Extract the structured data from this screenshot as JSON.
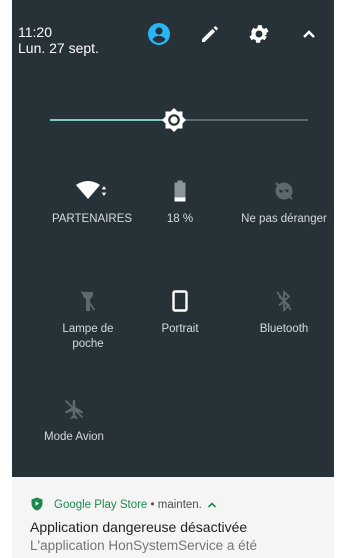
{
  "header": {
    "time": "11:20",
    "date": "Lun. 27 sept.",
    "icons": [
      "account-icon",
      "edit-icon",
      "settings-icon",
      "collapse-icon"
    ]
  },
  "brightness": {
    "level": 0.48
  },
  "tiles": [
    {
      "label": "PARTENAIRES",
      "icon": "wifi-icon",
      "active": true
    },
    {
      "label": "18 %",
      "icon": "battery-icon",
      "active": true
    },
    {
      "label": "Ne pas déranger",
      "icon": "do-not-disturb-icon",
      "active": false
    },
    {
      "label": "Lampe de poche",
      "icon": "flashlight-icon",
      "active": false
    },
    {
      "label": "Portrait",
      "icon": "portrait-icon",
      "active": true
    },
    {
      "label": "Bluetooth",
      "icon": "bluetooth-icon",
      "active": false
    },
    {
      "label": "Mode Avion",
      "icon": "airplane-icon",
      "active": false
    }
  ],
  "notification": {
    "app": "Google Play Store",
    "separator": " • ",
    "status": "mainten.",
    "title": "Application dangereuse désactivée",
    "body": "L'application HonSystemService a été"
  },
  "colors": {
    "shade": "#263238",
    "accent": "#80cbc4",
    "account": "#29b6f6",
    "play_store_green": "#1b8a4f"
  }
}
